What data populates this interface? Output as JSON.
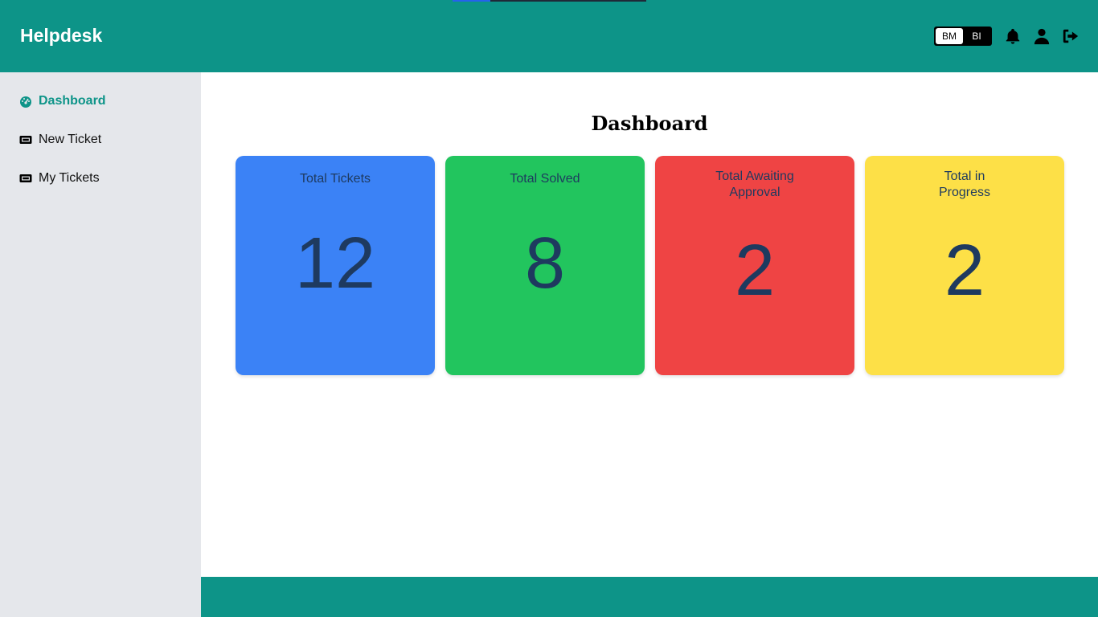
{
  "header": {
    "brand": "Helpdesk",
    "lang_options": [
      "BM",
      "BI"
    ],
    "icons": [
      "bell-icon",
      "user-icon",
      "logout-icon"
    ]
  },
  "sidebar": {
    "items": [
      {
        "label": "Dashboard",
        "icon": "dashboard-gauge-icon",
        "active": true
      },
      {
        "label": "New Ticket",
        "icon": "ticket-icon",
        "active": false
      },
      {
        "label": "My Tickets",
        "icon": "ticket-icon",
        "active": false
      }
    ]
  },
  "main": {
    "title": "Dashboard",
    "cards": [
      {
        "label": "Total Tickets",
        "value": "12",
        "color": "#3b82f6"
      },
      {
        "label": "Total Solved",
        "value": "8",
        "color": "#22c55e"
      },
      {
        "label_line1": "Total Awaiting",
        "label_line2": "Approval",
        "value": "2",
        "color": "#ef4444"
      },
      {
        "label_line1": "Total in",
        "label_line2": "Progress",
        "value": "2",
        "color": "#fde047"
      }
    ]
  },
  "colors": {
    "header_bg": "#0d9488",
    "sidebar_bg": "#e5e7eb",
    "footer_bg": "#0d9488",
    "card_text": "#1e3a5f"
  }
}
